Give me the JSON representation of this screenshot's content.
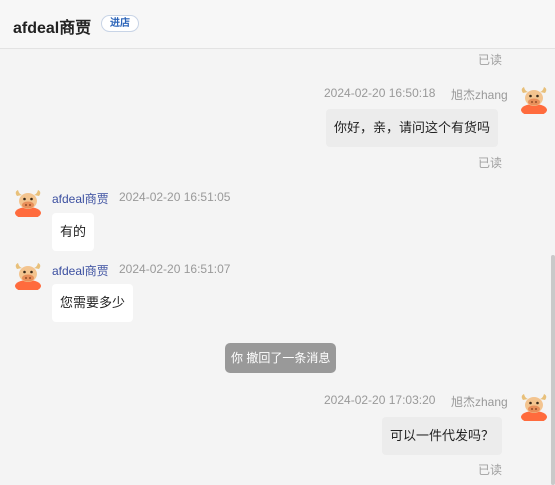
{
  "header": {
    "shop_name": "afdeal商贾",
    "enter_badge": "进店"
  },
  "messages": [
    {
      "status": "已读"
    },
    {
      "timestamp": "2024-02-20 16:50:18",
      "sender": "旭杰zhang",
      "text": "你好，亲，请问这个有货吗",
      "status": "已读"
    },
    {
      "sender": "afdeal商贾",
      "timestamp": "2024-02-20 16:51:05",
      "text": "有的"
    },
    {
      "sender": "afdeal商贾",
      "timestamp": "2024-02-20 16:51:07",
      "text": "您需要多少"
    },
    {
      "system": "你 撤回了一条消息"
    },
    {
      "timestamp": "2024-02-20 17:03:20",
      "sender": "旭杰zhang",
      "text": "可以一件代发吗？",
      "status": "已读"
    }
  ],
  "colors": {
    "avatar_body": "#ff6b3d",
    "avatar_horn": "#e8c07a",
    "accent_sender": "#3b4fa0"
  }
}
